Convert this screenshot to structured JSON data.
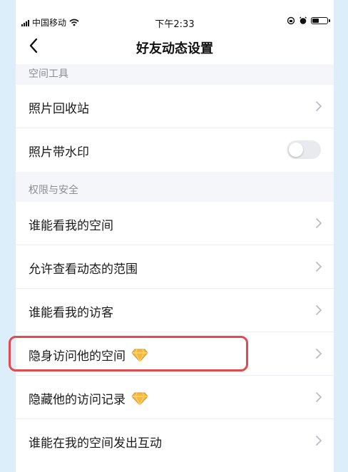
{
  "status_bar": {
    "carrier": "中国移动",
    "time": "下午2:33"
  },
  "nav": {
    "title": "好友动态设置"
  },
  "sections": [
    {
      "header": "空间工具",
      "items": [
        {
          "label": "照片回收站",
          "control": "chevron"
        },
        {
          "label": "照片带水印",
          "control": "toggle",
          "toggle_on": false
        }
      ]
    },
    {
      "header": "权限与安全",
      "items": [
        {
          "label": "谁能看我的空间",
          "control": "chevron"
        },
        {
          "label": "允许查看动态的范围",
          "control": "chevron"
        },
        {
          "label": "谁能看我的访客",
          "control": "chevron"
        },
        {
          "label": "隐身访问他的空间",
          "control": "chevron",
          "badge": "diamond-icon",
          "highlighted": true
        },
        {
          "label": "隐藏他的访问记录",
          "control": "chevron",
          "badge": "diamond-icon"
        },
        {
          "label": "谁能在我的空间发出互动",
          "control": "chevron"
        }
      ]
    }
  ],
  "colors": {
    "highlight": "#e24a4f",
    "background": "#f5f6fa",
    "frame": "#dbeef9",
    "diamond": "#f5b83d"
  }
}
